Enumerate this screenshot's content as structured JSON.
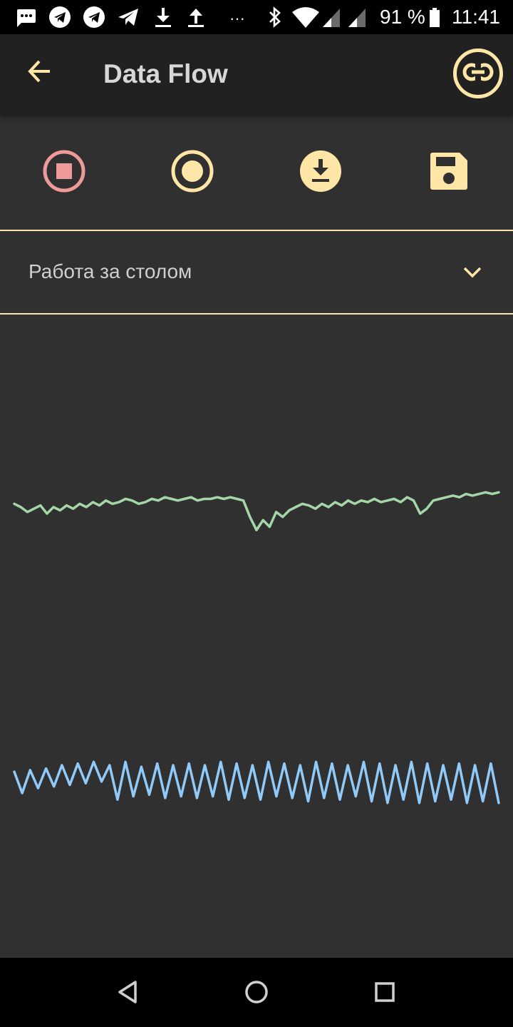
{
  "status_bar": {
    "battery_percent": "91 %",
    "time": "11:41",
    "overflow": "···",
    "icons": [
      "message-icon",
      "telegram-icon",
      "telegram-icon",
      "telegram-send-icon",
      "download-icon",
      "upload-icon",
      "bluetooth-icon",
      "wifi-icon",
      "signal-icon",
      "signal-icon",
      "battery-icon"
    ]
  },
  "app_bar": {
    "title": "Data Flow",
    "back_icon": "arrow-back-icon",
    "action_icon": "link-icon"
  },
  "toolbar": {
    "buttons": [
      {
        "name": "stop",
        "icon": "stop-circle-icon"
      },
      {
        "name": "record",
        "icon": "record-circle-icon"
      },
      {
        "name": "download",
        "icon": "download-circle-icon"
      },
      {
        "name": "save",
        "icon": "floppy-save-icon"
      }
    ]
  },
  "dropdown": {
    "selected": "Работа за столом",
    "icon": "chevron-down-icon"
  },
  "chart_data": {
    "type": "line",
    "title": "",
    "xlabel": "",
    "ylabel": "",
    "grid": false,
    "legend": "none",
    "series": [
      {
        "color": "#a5d6a7",
        "values": [
          2,
          0,
          -3,
          -1,
          1,
          -4,
          0,
          -2,
          1,
          -1,
          2,
          0,
          3,
          1,
          4,
          2,
          3,
          5,
          4,
          2,
          3,
          5,
          4,
          6,
          5,
          4,
          5,
          6,
          4,
          5,
          5,
          6,
          5,
          6,
          5,
          4,
          -6,
          -14,
          -8,
          -12,
          -3,
          -6,
          -2,
          0,
          2,
          1,
          -1,
          2,
          0,
          3,
          1,
          4,
          2,
          4,
          3,
          5,
          3,
          4,
          5,
          3,
          6,
          4,
          -4,
          -1,
          4,
          5,
          6,
          7,
          6,
          8,
          7,
          8,
          9,
          8,
          9
        ]
      },
      {
        "color": "#90caf9",
        "values": [
          3,
          -10,
          4,
          -7,
          5,
          -6,
          7,
          -5,
          8,
          -4,
          9,
          -3,
          7,
          -14,
          9,
          -12,
          6,
          -11,
          8,
          -13,
          7,
          -12,
          8,
          -13,
          7,
          -12,
          9,
          -14,
          8,
          -13,
          7,
          -14,
          9,
          -12,
          8,
          -13,
          7,
          -15,
          9,
          -13,
          8,
          -14,
          7,
          -12,
          9,
          -15,
          8,
          -16,
          7,
          -14,
          9,
          -16,
          8,
          -15,
          7,
          -14,
          8,
          -16,
          7,
          -15,
          8,
          -16
        ]
      }
    ]
  },
  "nav_bar": {
    "icons": [
      "nav-back-icon",
      "nav-home-icon",
      "nav-recents-icon"
    ]
  }
}
